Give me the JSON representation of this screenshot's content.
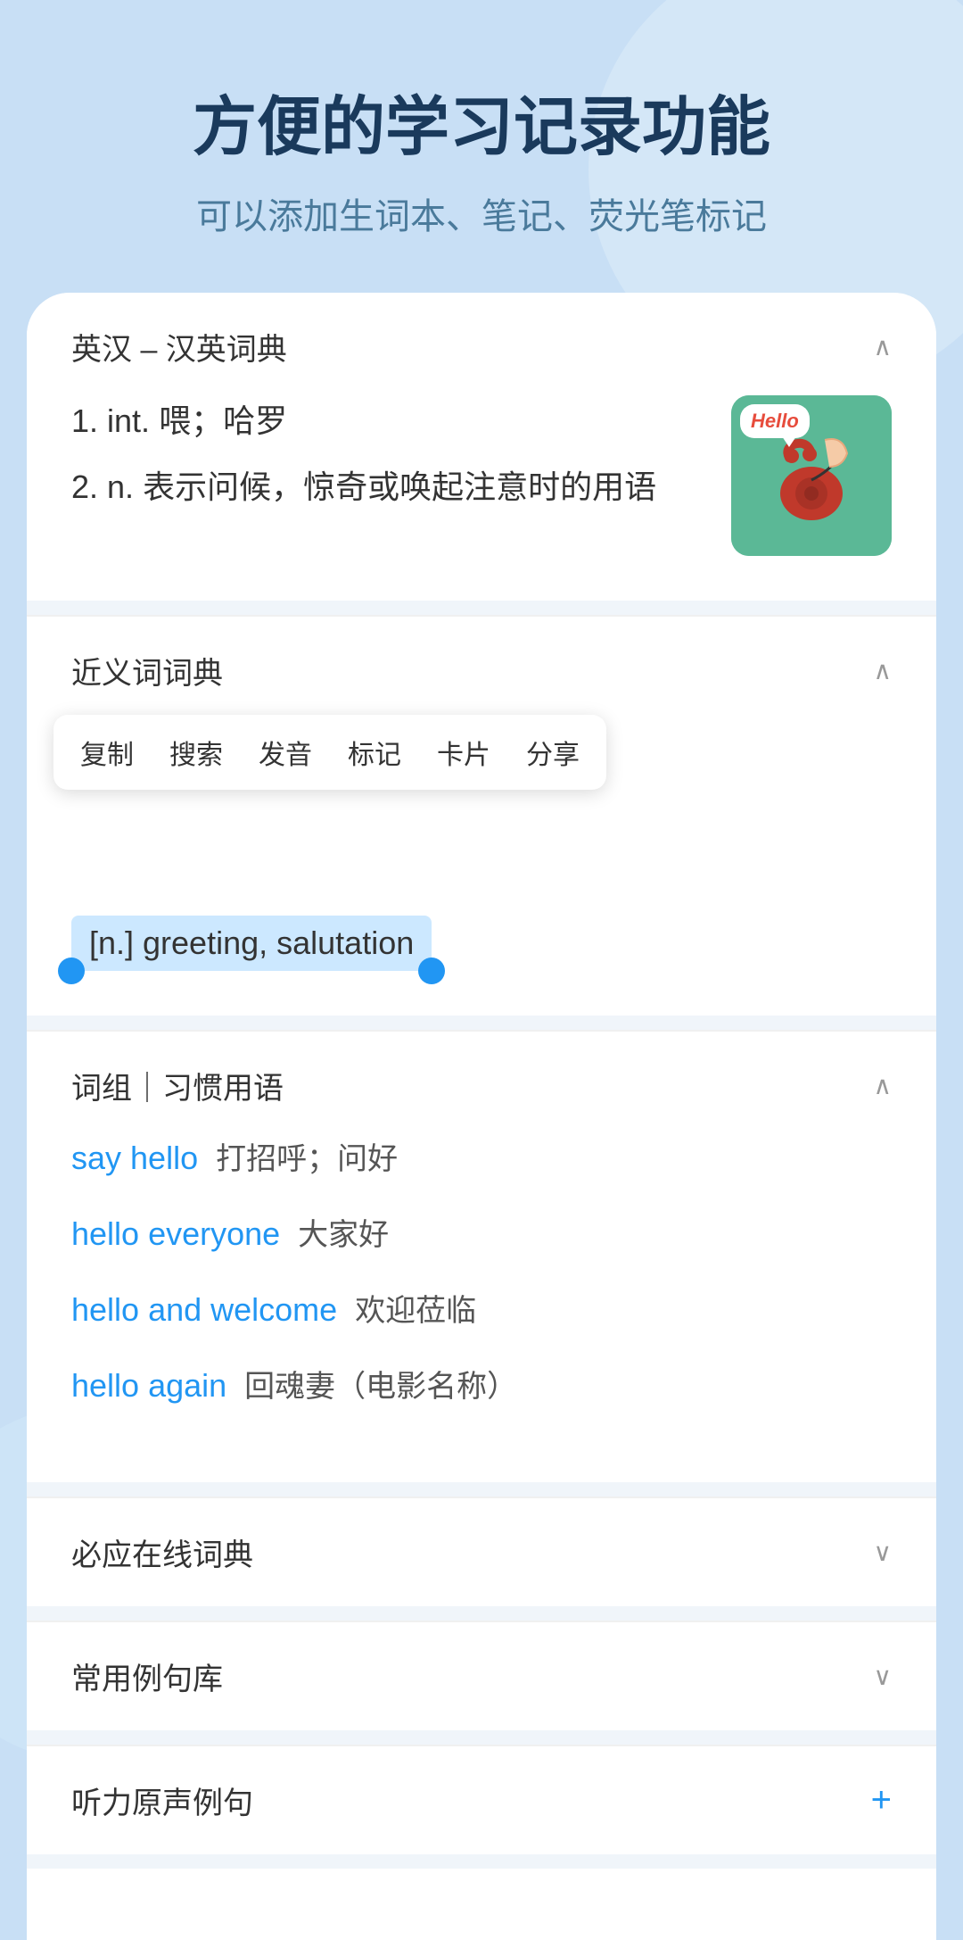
{
  "header": {
    "title": "方便的学习记录功能",
    "subtitle": "可以添加生词本、笔记、荧光笔标记"
  },
  "dictionary": {
    "section_title": "英汉 – 汉英词典",
    "entries": [
      {
        "num": "1.",
        "pos": "int.",
        "definition": "喂；哈罗"
      },
      {
        "num": "2.",
        "pos": "n.",
        "definition": "表示问候，惊奇或唤起注意时的用语"
      }
    ],
    "image_alt": "Hello telephone illustration",
    "speech_bubble": "Hello"
  },
  "synonyms": {
    "section_title": "近义词词典",
    "context_menu": {
      "items": [
        "复制",
        "搜索",
        "发音",
        "标记",
        "卡片",
        "分享"
      ]
    },
    "highlighted_text": "[n.] greeting, salutation"
  },
  "phrases": {
    "section_title": "词组｜习惯用语",
    "items": [
      {
        "en": "say hello",
        "zh": "打招呼；问好"
      },
      {
        "en": "hello everyone",
        "zh": "大家好"
      },
      {
        "en": "hello and welcome",
        "zh": "欢迎莅临"
      },
      {
        "en": "hello again",
        "zh": "回魂妻（电影名称）"
      }
    ]
  },
  "collapsed_sections": [
    {
      "title": "必应在线词典",
      "icon": "chevron-down"
    },
    {
      "title": "常用例句库",
      "icon": "chevron-down"
    },
    {
      "title": "听力原声例句",
      "icon": "plus"
    }
  ],
  "icons": {
    "chevron_up": "∧",
    "chevron_down": "∨",
    "plus": "+"
  }
}
